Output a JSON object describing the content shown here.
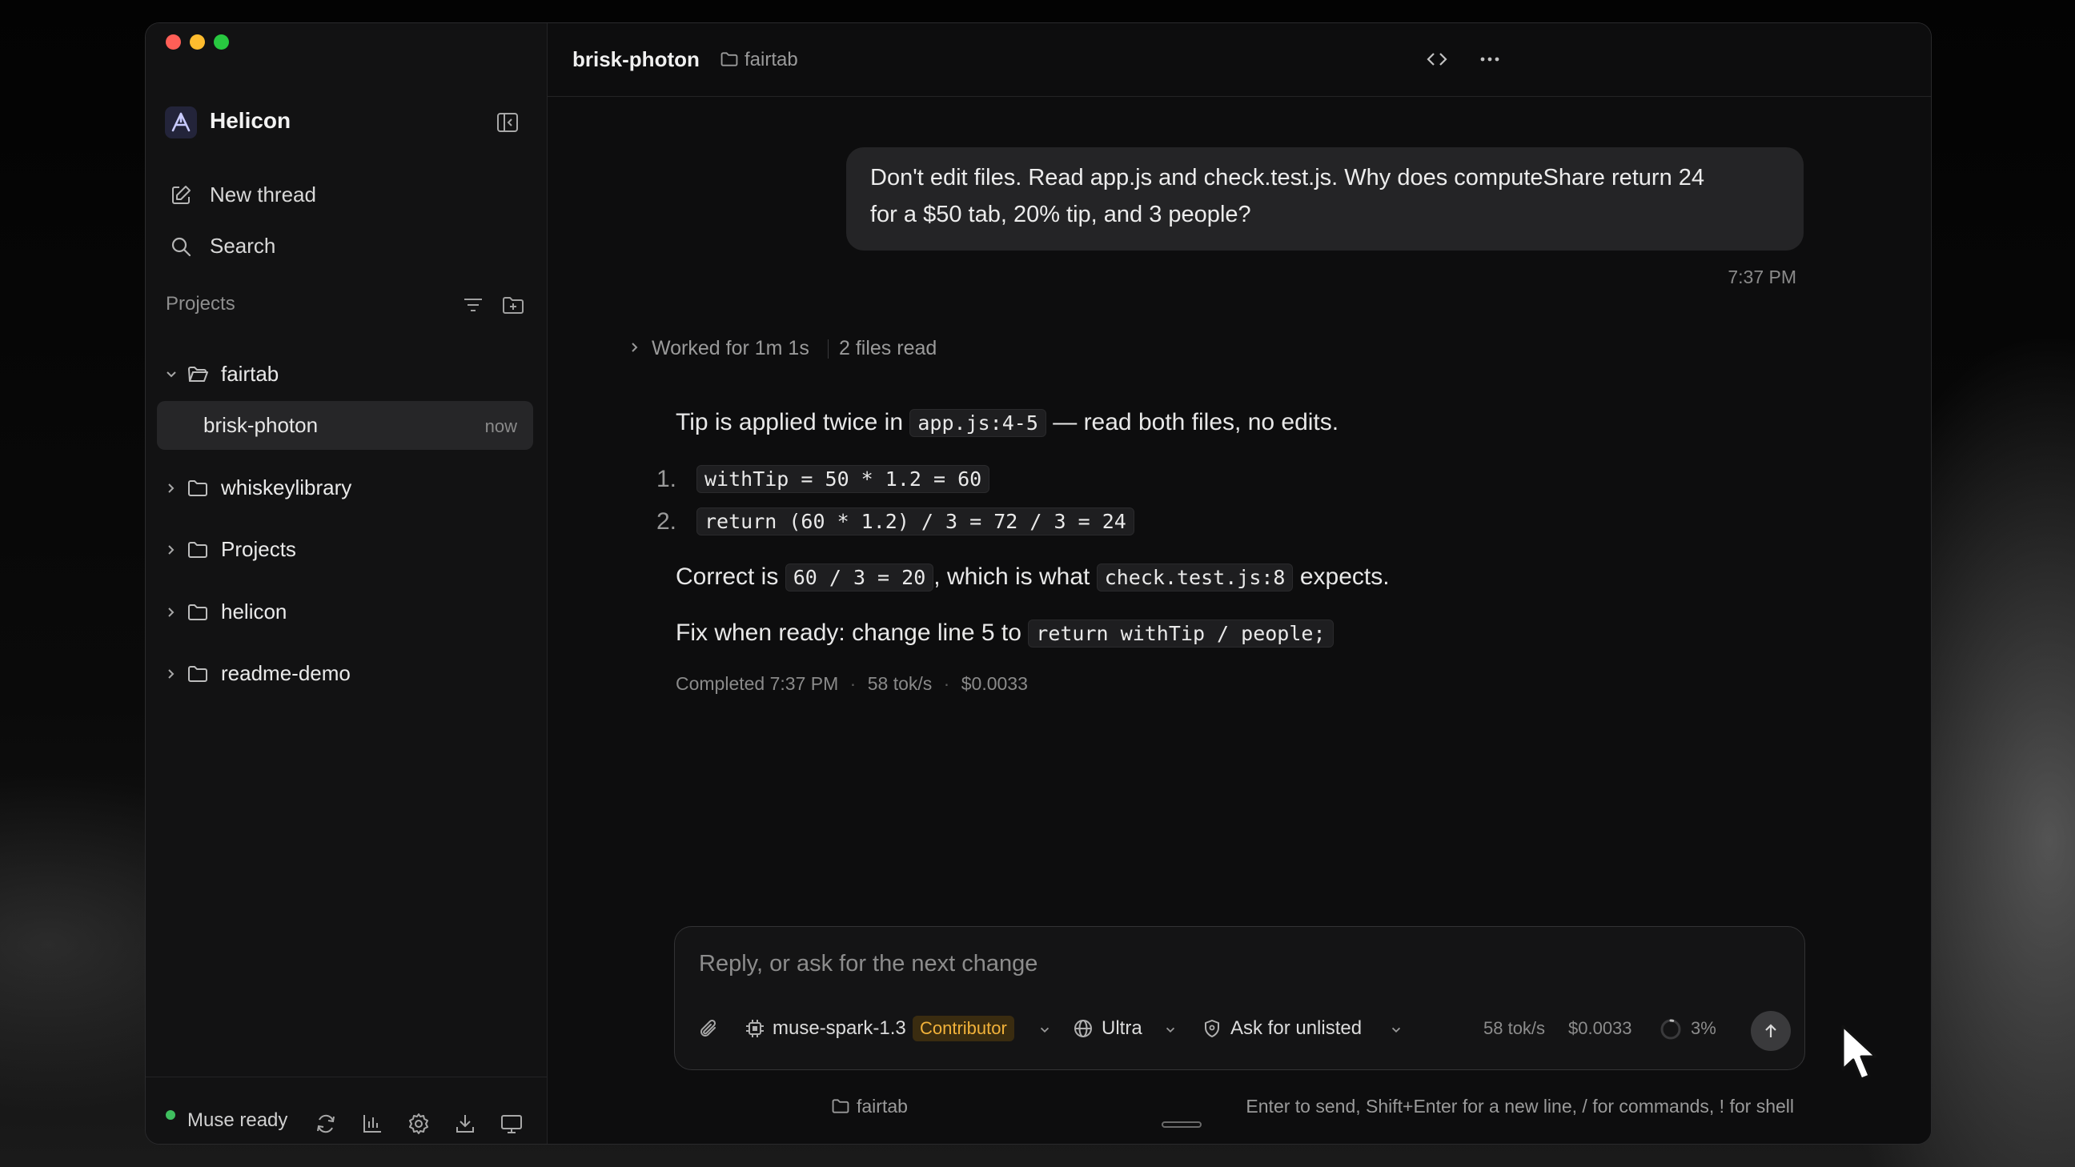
{
  "app": {
    "name": "Helicon"
  },
  "sidebar": {
    "new_thread": "New thread",
    "search": "Search",
    "projects_header": "Projects",
    "projects": [
      {
        "name": "fairtab",
        "expanded": true,
        "threads": [
          {
            "name": "brisk-photon",
            "time": "now"
          }
        ]
      },
      {
        "name": "whiskeylibrary",
        "expanded": false
      },
      {
        "name": "Projects",
        "expanded": false
      },
      {
        "name": "helicon",
        "expanded": false
      },
      {
        "name": "readme-demo",
        "expanded": false
      }
    ],
    "status": "Muse ready"
  },
  "header": {
    "thread": "brisk-photon",
    "project": "fairtab"
  },
  "conversation": {
    "user_message": {
      "line1": "Don't edit files. Read app.js and check.test.js. Why does computeShare return 24",
      "line2": "for a $50 tab, 20% tip, and 3 people?",
      "time": "7:37 PM"
    },
    "work_summary": {
      "worked": "Worked for 1m 1s",
      "files": "2 files read"
    },
    "reply": {
      "p1_before": "Tip is applied twice in",
      "p1_code": "app.js:4-5",
      "p1_after": "— read both files, no edits.",
      "list": [
        {
          "num": "1.",
          "code": "withTip = 50 * 1.2 = 60"
        },
        {
          "num": "2.",
          "code": "return (60 * 1.2) / 3 = 72 / 3 = 24"
        }
      ],
      "p2_before": "Correct is",
      "p2_code1": "60 / 3 = 20",
      "p2_middle": ", which is what",
      "p2_code2": "check.test.js:8",
      "p2_after": "expects.",
      "p3_before": "Fix when ready: change line 5 to",
      "p3_code": "return withTip / people;",
      "meta": {
        "completed": "Completed 7:37 PM",
        "speed": "58 tok/s",
        "cost": "$0.0033"
      }
    }
  },
  "composer": {
    "placeholder": "Reply, or ask for the next change",
    "model": "muse-spark-1.3",
    "role_badge": "Contributor",
    "effort": "Ultra",
    "permission": "Ask for unlisted",
    "speed": "58 tok/s",
    "cost": "$0.0033",
    "context_percent": "3%",
    "context_fraction": 0.03
  },
  "footer": {
    "project": "fairtab",
    "hint": "Enter to send, Shift+Enter for a new line, / for commands, ! for shell"
  },
  "colors": {
    "accent_badge_bg": "#3a2c10",
    "accent_badge_text": "#f2b23a",
    "status_dot": "#3fbf5f",
    "traffic_red": "#ff5f57",
    "traffic_yellow": "#febc2e",
    "traffic_green": "#28c840"
  }
}
